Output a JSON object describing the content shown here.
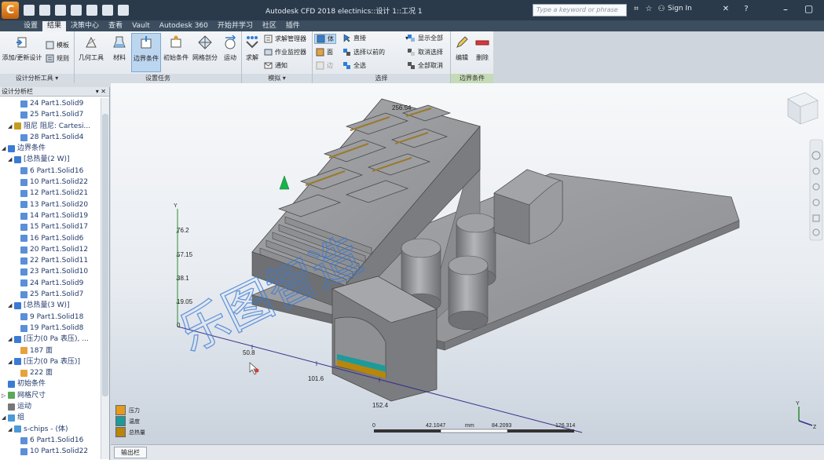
{
  "titlebar": {
    "app_letter": "C",
    "title": "Autodesk CFD 2018  electinics::设计 1::工况 1",
    "search_placeholder": "Type a keyword or phrase",
    "signin": "Sign In"
  },
  "menu_tabs": [
    "设置",
    "结果",
    "决策中心",
    "查看",
    "Vault",
    "Autodesk 360",
    "开始并学习",
    "社区",
    "插件"
  ],
  "ribbon": {
    "groups": {
      "design_tools": "设计分析工具 ▾",
      "setup_tasks": "设置任务",
      "simulation": "模拟 ▾",
      "selection": "选择",
      "boundary": "边界条件"
    },
    "add_update_design": "添加/更新设计",
    "template": "模板",
    "rules": "规则",
    "geometry_tools": "几何工具",
    "material": "材料",
    "boundary_conditions": "边界条件",
    "initial_conditions": "初始条件",
    "mesh_sizing": "网格剖分",
    "motion": "运动",
    "solve": "求解",
    "solve_manager": "求解管理器",
    "job_monitor": "作业监控器",
    "notify": "通知",
    "sel_body": "体",
    "sel_face": "面",
    "sel_edge": "边",
    "direct": "直接",
    "select_previous": "选择以前的",
    "select_all": "全选",
    "show_all": "显示全部",
    "cancel_selection": "取消选择",
    "deselect_all": "全部取消",
    "edit": "编辑",
    "delete": "删除"
  },
  "panel": {
    "title": "设计分析栏",
    "tree": [
      {
        "indent": 3,
        "icon": "part",
        "text": "24 Part1.Solid9"
      },
      {
        "indent": 3,
        "icon": "part",
        "text": "25 Part1.Solid7"
      },
      {
        "indent": 2,
        "icon": "damper",
        "tog": "◢",
        "text": "阻尼 阻尼: Cartesi..."
      },
      {
        "indent": 3,
        "icon": "part",
        "text": "28 Part1.Solid4"
      },
      {
        "indent": 1,
        "icon": "bc",
        "tog": "◢",
        "text": "边界条件"
      },
      {
        "indent": 2,
        "icon": "bc",
        "tog": "◢",
        "text": "[总热量(2 W)]"
      },
      {
        "indent": 3,
        "icon": "part",
        "text": "6 Part1.Solid16"
      },
      {
        "indent": 3,
        "icon": "part",
        "text": "10 Part1.Solid22"
      },
      {
        "indent": 3,
        "icon": "part",
        "text": "12 Part1.Solid21"
      },
      {
        "indent": 3,
        "icon": "part",
        "text": "13 Part1.Solid20"
      },
      {
        "indent": 3,
        "icon": "part",
        "text": "14 Part1.Solid19"
      },
      {
        "indent": 3,
        "icon": "part",
        "text": "15 Part1.Solid17"
      },
      {
        "indent": 3,
        "icon": "part",
        "text": "16 Part1.Solid6"
      },
      {
        "indent": 3,
        "icon": "part",
        "text": "20 Part1.Solid12"
      },
      {
        "indent": 3,
        "icon": "part",
        "text": "22 Part1.Solid11"
      },
      {
        "indent": 3,
        "icon": "part",
        "text": "23 Part1.Solid10"
      },
      {
        "indent": 3,
        "icon": "part",
        "text": "24 Part1.Solid9"
      },
      {
        "indent": 3,
        "icon": "part",
        "text": "25 Part1.Solid7"
      },
      {
        "indent": 2,
        "icon": "bc",
        "tog": "◢",
        "text": "[总热量(3 W)]"
      },
      {
        "indent": 3,
        "icon": "part",
        "text": "9 Part1.Solid18"
      },
      {
        "indent": 3,
        "icon": "part",
        "text": "19 Part1.Solid8"
      },
      {
        "indent": 2,
        "icon": "bc",
        "tog": "◢",
        "text": "[压力(0 Pa 表压), ..."
      },
      {
        "indent": 3,
        "icon": "face",
        "text": "187 面"
      },
      {
        "indent": 2,
        "icon": "bc",
        "tog": "◢",
        "text": "[压力(0 Pa 表压)]"
      },
      {
        "indent": 3,
        "icon": "face",
        "text": "222 面"
      },
      {
        "indent": 1,
        "icon": "bc",
        "text": "初始条件"
      },
      {
        "indent": 1,
        "icon": "mesh",
        "tog": "▷",
        "text": "网格尺寸"
      },
      {
        "indent": 1,
        "icon": "motion",
        "text": "运动"
      },
      {
        "indent": 1,
        "icon": "group",
        "tog": "◢",
        "text": "组"
      },
      {
        "indent": 2,
        "icon": "group",
        "tog": "◢",
        "text": "s-chips - (体)"
      },
      {
        "indent": 3,
        "icon": "part",
        "text": "6 Part1.Solid16"
      },
      {
        "indent": 3,
        "icon": "part",
        "text": "10 Part1.Solid22"
      }
    ]
  },
  "viewport": {
    "watermark": "乐图智造",
    "dim_top": "256.54",
    "axis_y_label": "Y",
    "y_ticks": [
      "76.2",
      "57.15",
      "38.1",
      "19.05",
      "0"
    ],
    "x_ticks": [
      "50.8",
      "101.6",
      "152.4"
    ],
    "scale": {
      "t0": "0",
      "t1": "42.1047",
      "unit": "mm",
      "t2": "84.2093",
      "t3": "126.314"
    },
    "legend": [
      {
        "label": "压力",
        "color": "#e39a1e"
      },
      {
        "label": "温度",
        "color": "#1e9a9a"
      },
      {
        "label": "总热量",
        "color": "#b8860b"
      }
    ],
    "triad": {
      "y": "Y",
      "z": "Z"
    }
  },
  "bottom": {
    "output_tab": "输出栏"
  },
  "colors": {
    "accent": "#2f7fd1",
    "titlebar": "#2b3a4a",
    "model": "#8f9092"
  }
}
